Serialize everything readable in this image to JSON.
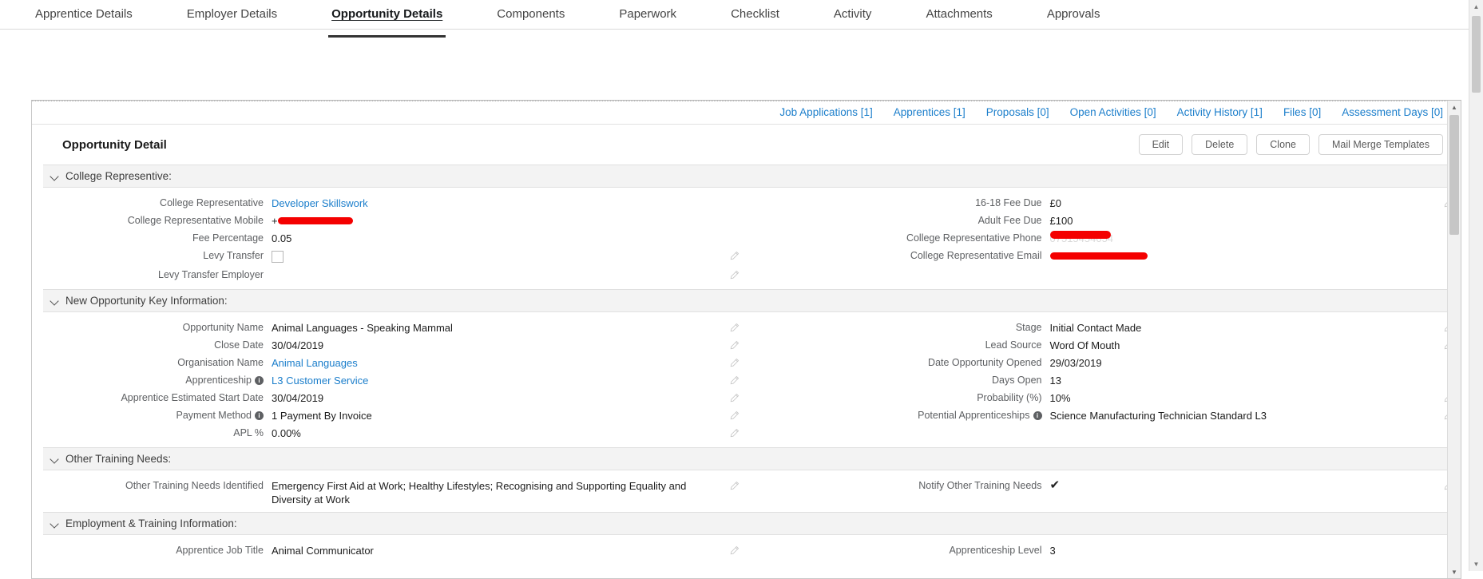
{
  "tabs": [
    {
      "label": "Apprentice Details",
      "active": false
    },
    {
      "label": "Employer Details",
      "active": false
    },
    {
      "label": "Opportunity Details",
      "active": true
    },
    {
      "label": "Components",
      "active": false
    },
    {
      "label": "Paperwork",
      "active": false
    },
    {
      "label": "Checklist",
      "active": false
    },
    {
      "label": "Activity",
      "active": false
    },
    {
      "label": "Attachments",
      "active": false
    },
    {
      "label": "Approvals",
      "active": false
    }
  ],
  "related_links": [
    {
      "label": "Job Applications [1]"
    },
    {
      "label": "Apprentices [1]"
    },
    {
      "label": "Proposals [0]"
    },
    {
      "label": "Open Activities [0]"
    },
    {
      "label": "Activity History [1]"
    },
    {
      "label": "Files [0]"
    },
    {
      "label": "Assessment Days [0]"
    }
  ],
  "detail": {
    "title": "Opportunity Detail",
    "buttons": [
      {
        "label": "Edit"
      },
      {
        "label": "Delete"
      },
      {
        "label": "Clone"
      },
      {
        "label": "Mail Merge Templates"
      }
    ]
  },
  "sections": [
    {
      "title": "College Representive:",
      "left": [
        {
          "label": "College Representative",
          "value": "Developer Skillswork",
          "type": "link",
          "pencil": false
        },
        {
          "label": "College Representative Mobile",
          "value": "+",
          "type": "redacted",
          "redact_width": 94,
          "pencil": false
        },
        {
          "label": "Fee Percentage",
          "value": "0.05",
          "type": "text",
          "pencil": false
        },
        {
          "label": "Levy Transfer",
          "value": "",
          "type": "checkbox",
          "pencil": true
        },
        {
          "label": "Levy Transfer Employer",
          "value": "",
          "type": "text",
          "pencil": true
        }
      ],
      "right": [
        {
          "label": "16-18 Fee Due",
          "value": "£0",
          "type": "text",
          "pencil": true
        },
        {
          "label": "Adult Fee Due",
          "value": "£100",
          "type": "text",
          "pencil": false
        },
        {
          "label": "College Representative Phone",
          "value": "07515454054",
          "type": "redacted-over",
          "redact_width": 76,
          "pencil": false
        },
        {
          "label": "College Representative Email",
          "value": "",
          "type": "redacted",
          "redact_width": 122,
          "pencil": false
        }
      ]
    },
    {
      "title": "New Opportunity Key Information:",
      "left": [
        {
          "label": "Opportunity Name",
          "value": "Animal Languages - Speaking Mammal",
          "type": "text",
          "pencil": true
        },
        {
          "label": "Close Date",
          "value": "30/04/2019",
          "type": "text",
          "pencil": true
        },
        {
          "label": "Organisation Name",
          "value": "Animal Languages",
          "type": "link",
          "pencil": true
        },
        {
          "label": "Apprenticeship",
          "value": "L3 Customer Service",
          "type": "link",
          "pencil": true,
          "info": true
        },
        {
          "label": "Apprentice Estimated Start Date",
          "value": "30/04/2019",
          "type": "text",
          "pencil": true
        },
        {
          "label": "Payment Method",
          "value": "1 Payment By Invoice",
          "type": "text",
          "pencil": true,
          "info": true
        },
        {
          "label": "APL %",
          "value": "0.00%",
          "type": "text",
          "pencil": true
        }
      ],
      "right": [
        {
          "label": "Stage",
          "value": "Initial Contact Made",
          "type": "text",
          "pencil": true
        },
        {
          "label": "Lead Source",
          "value": "Word Of Mouth",
          "type": "text",
          "pencil": true
        },
        {
          "label": "Date Opportunity Opened",
          "value": "29/03/2019",
          "type": "text",
          "pencil": false
        },
        {
          "label": "Days Open",
          "value": "13",
          "type": "text",
          "pencil": false
        },
        {
          "label": "Probability (%)",
          "value": "10%",
          "type": "text",
          "pencil": true
        },
        {
          "label": "Potential Apprenticeships",
          "value": "Science Manufacturing Technician Standard L3",
          "type": "text",
          "pencil": true,
          "info": true
        }
      ]
    },
    {
      "title": "Other Training Needs:",
      "left": [
        {
          "label": "Other Training Needs Identified",
          "value": "Emergency First Aid at Work; Healthy Lifestyles; Recognising and Supporting Equality and Diversity at Work",
          "type": "text",
          "pencil": true
        }
      ],
      "right": [
        {
          "label": "Notify Other Training Needs",
          "value": "",
          "type": "tick",
          "pencil": true
        }
      ]
    },
    {
      "title": "Employment & Training Information:",
      "left": [
        {
          "label": "Apprentice Job Title",
          "value": "Animal Communicator",
          "type": "text",
          "pencil": true
        }
      ],
      "right": [
        {
          "label": "Apprenticeship Level",
          "value": "3",
          "type": "text",
          "pencil": false
        }
      ]
    }
  ],
  "icons": {
    "chevron_down": "chevron-down-icon",
    "pencil": "pencil-edit-icon",
    "scroll_up": "▲",
    "scroll_down": "▼",
    "tick": "✔"
  },
  "colors": {
    "link": "#1b7ecb",
    "section_bg": "#f3f3f3",
    "redaction": "#f40000",
    "text": "#1c1c1c",
    "label": "#5e6063"
  }
}
